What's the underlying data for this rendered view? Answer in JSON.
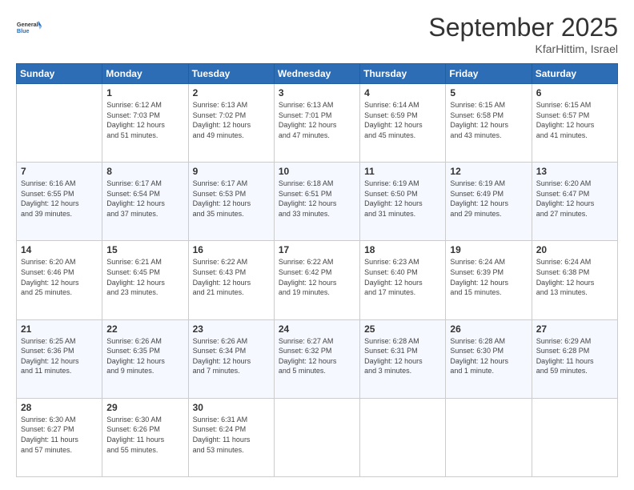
{
  "header": {
    "logo_line1": "General",
    "logo_line2": "Blue",
    "month_title": "September 2025",
    "location": "KfarHittim, Israel"
  },
  "days_of_week": [
    "Sunday",
    "Monday",
    "Tuesday",
    "Wednesday",
    "Thursday",
    "Friday",
    "Saturday"
  ],
  "weeks": [
    [
      {
        "day": "",
        "info": ""
      },
      {
        "day": "1",
        "info": "Sunrise: 6:12 AM\nSunset: 7:03 PM\nDaylight: 12 hours\nand 51 minutes."
      },
      {
        "day": "2",
        "info": "Sunrise: 6:13 AM\nSunset: 7:02 PM\nDaylight: 12 hours\nand 49 minutes."
      },
      {
        "day": "3",
        "info": "Sunrise: 6:13 AM\nSunset: 7:01 PM\nDaylight: 12 hours\nand 47 minutes."
      },
      {
        "day": "4",
        "info": "Sunrise: 6:14 AM\nSunset: 6:59 PM\nDaylight: 12 hours\nand 45 minutes."
      },
      {
        "day": "5",
        "info": "Sunrise: 6:15 AM\nSunset: 6:58 PM\nDaylight: 12 hours\nand 43 minutes."
      },
      {
        "day": "6",
        "info": "Sunrise: 6:15 AM\nSunset: 6:57 PM\nDaylight: 12 hours\nand 41 minutes."
      }
    ],
    [
      {
        "day": "7",
        "info": "Sunrise: 6:16 AM\nSunset: 6:55 PM\nDaylight: 12 hours\nand 39 minutes."
      },
      {
        "day": "8",
        "info": "Sunrise: 6:17 AM\nSunset: 6:54 PM\nDaylight: 12 hours\nand 37 minutes."
      },
      {
        "day": "9",
        "info": "Sunrise: 6:17 AM\nSunset: 6:53 PM\nDaylight: 12 hours\nand 35 minutes."
      },
      {
        "day": "10",
        "info": "Sunrise: 6:18 AM\nSunset: 6:51 PM\nDaylight: 12 hours\nand 33 minutes."
      },
      {
        "day": "11",
        "info": "Sunrise: 6:19 AM\nSunset: 6:50 PM\nDaylight: 12 hours\nand 31 minutes."
      },
      {
        "day": "12",
        "info": "Sunrise: 6:19 AM\nSunset: 6:49 PM\nDaylight: 12 hours\nand 29 minutes."
      },
      {
        "day": "13",
        "info": "Sunrise: 6:20 AM\nSunset: 6:47 PM\nDaylight: 12 hours\nand 27 minutes."
      }
    ],
    [
      {
        "day": "14",
        "info": "Sunrise: 6:20 AM\nSunset: 6:46 PM\nDaylight: 12 hours\nand 25 minutes."
      },
      {
        "day": "15",
        "info": "Sunrise: 6:21 AM\nSunset: 6:45 PM\nDaylight: 12 hours\nand 23 minutes."
      },
      {
        "day": "16",
        "info": "Sunrise: 6:22 AM\nSunset: 6:43 PM\nDaylight: 12 hours\nand 21 minutes."
      },
      {
        "day": "17",
        "info": "Sunrise: 6:22 AM\nSunset: 6:42 PM\nDaylight: 12 hours\nand 19 minutes."
      },
      {
        "day": "18",
        "info": "Sunrise: 6:23 AM\nSunset: 6:40 PM\nDaylight: 12 hours\nand 17 minutes."
      },
      {
        "day": "19",
        "info": "Sunrise: 6:24 AM\nSunset: 6:39 PM\nDaylight: 12 hours\nand 15 minutes."
      },
      {
        "day": "20",
        "info": "Sunrise: 6:24 AM\nSunset: 6:38 PM\nDaylight: 12 hours\nand 13 minutes."
      }
    ],
    [
      {
        "day": "21",
        "info": "Sunrise: 6:25 AM\nSunset: 6:36 PM\nDaylight: 12 hours\nand 11 minutes."
      },
      {
        "day": "22",
        "info": "Sunrise: 6:26 AM\nSunset: 6:35 PM\nDaylight: 12 hours\nand 9 minutes."
      },
      {
        "day": "23",
        "info": "Sunrise: 6:26 AM\nSunset: 6:34 PM\nDaylight: 12 hours\nand 7 minutes."
      },
      {
        "day": "24",
        "info": "Sunrise: 6:27 AM\nSunset: 6:32 PM\nDaylight: 12 hours\nand 5 minutes."
      },
      {
        "day": "25",
        "info": "Sunrise: 6:28 AM\nSunset: 6:31 PM\nDaylight: 12 hours\nand 3 minutes."
      },
      {
        "day": "26",
        "info": "Sunrise: 6:28 AM\nSunset: 6:30 PM\nDaylight: 12 hours\nand 1 minute."
      },
      {
        "day": "27",
        "info": "Sunrise: 6:29 AM\nSunset: 6:28 PM\nDaylight: 11 hours\nand 59 minutes."
      }
    ],
    [
      {
        "day": "28",
        "info": "Sunrise: 6:30 AM\nSunset: 6:27 PM\nDaylight: 11 hours\nand 57 minutes."
      },
      {
        "day": "29",
        "info": "Sunrise: 6:30 AM\nSunset: 6:26 PM\nDaylight: 11 hours\nand 55 minutes."
      },
      {
        "day": "30",
        "info": "Sunrise: 6:31 AM\nSunset: 6:24 PM\nDaylight: 11 hours\nand 53 minutes."
      },
      {
        "day": "",
        "info": ""
      },
      {
        "day": "",
        "info": ""
      },
      {
        "day": "",
        "info": ""
      },
      {
        "day": "",
        "info": ""
      }
    ]
  ]
}
